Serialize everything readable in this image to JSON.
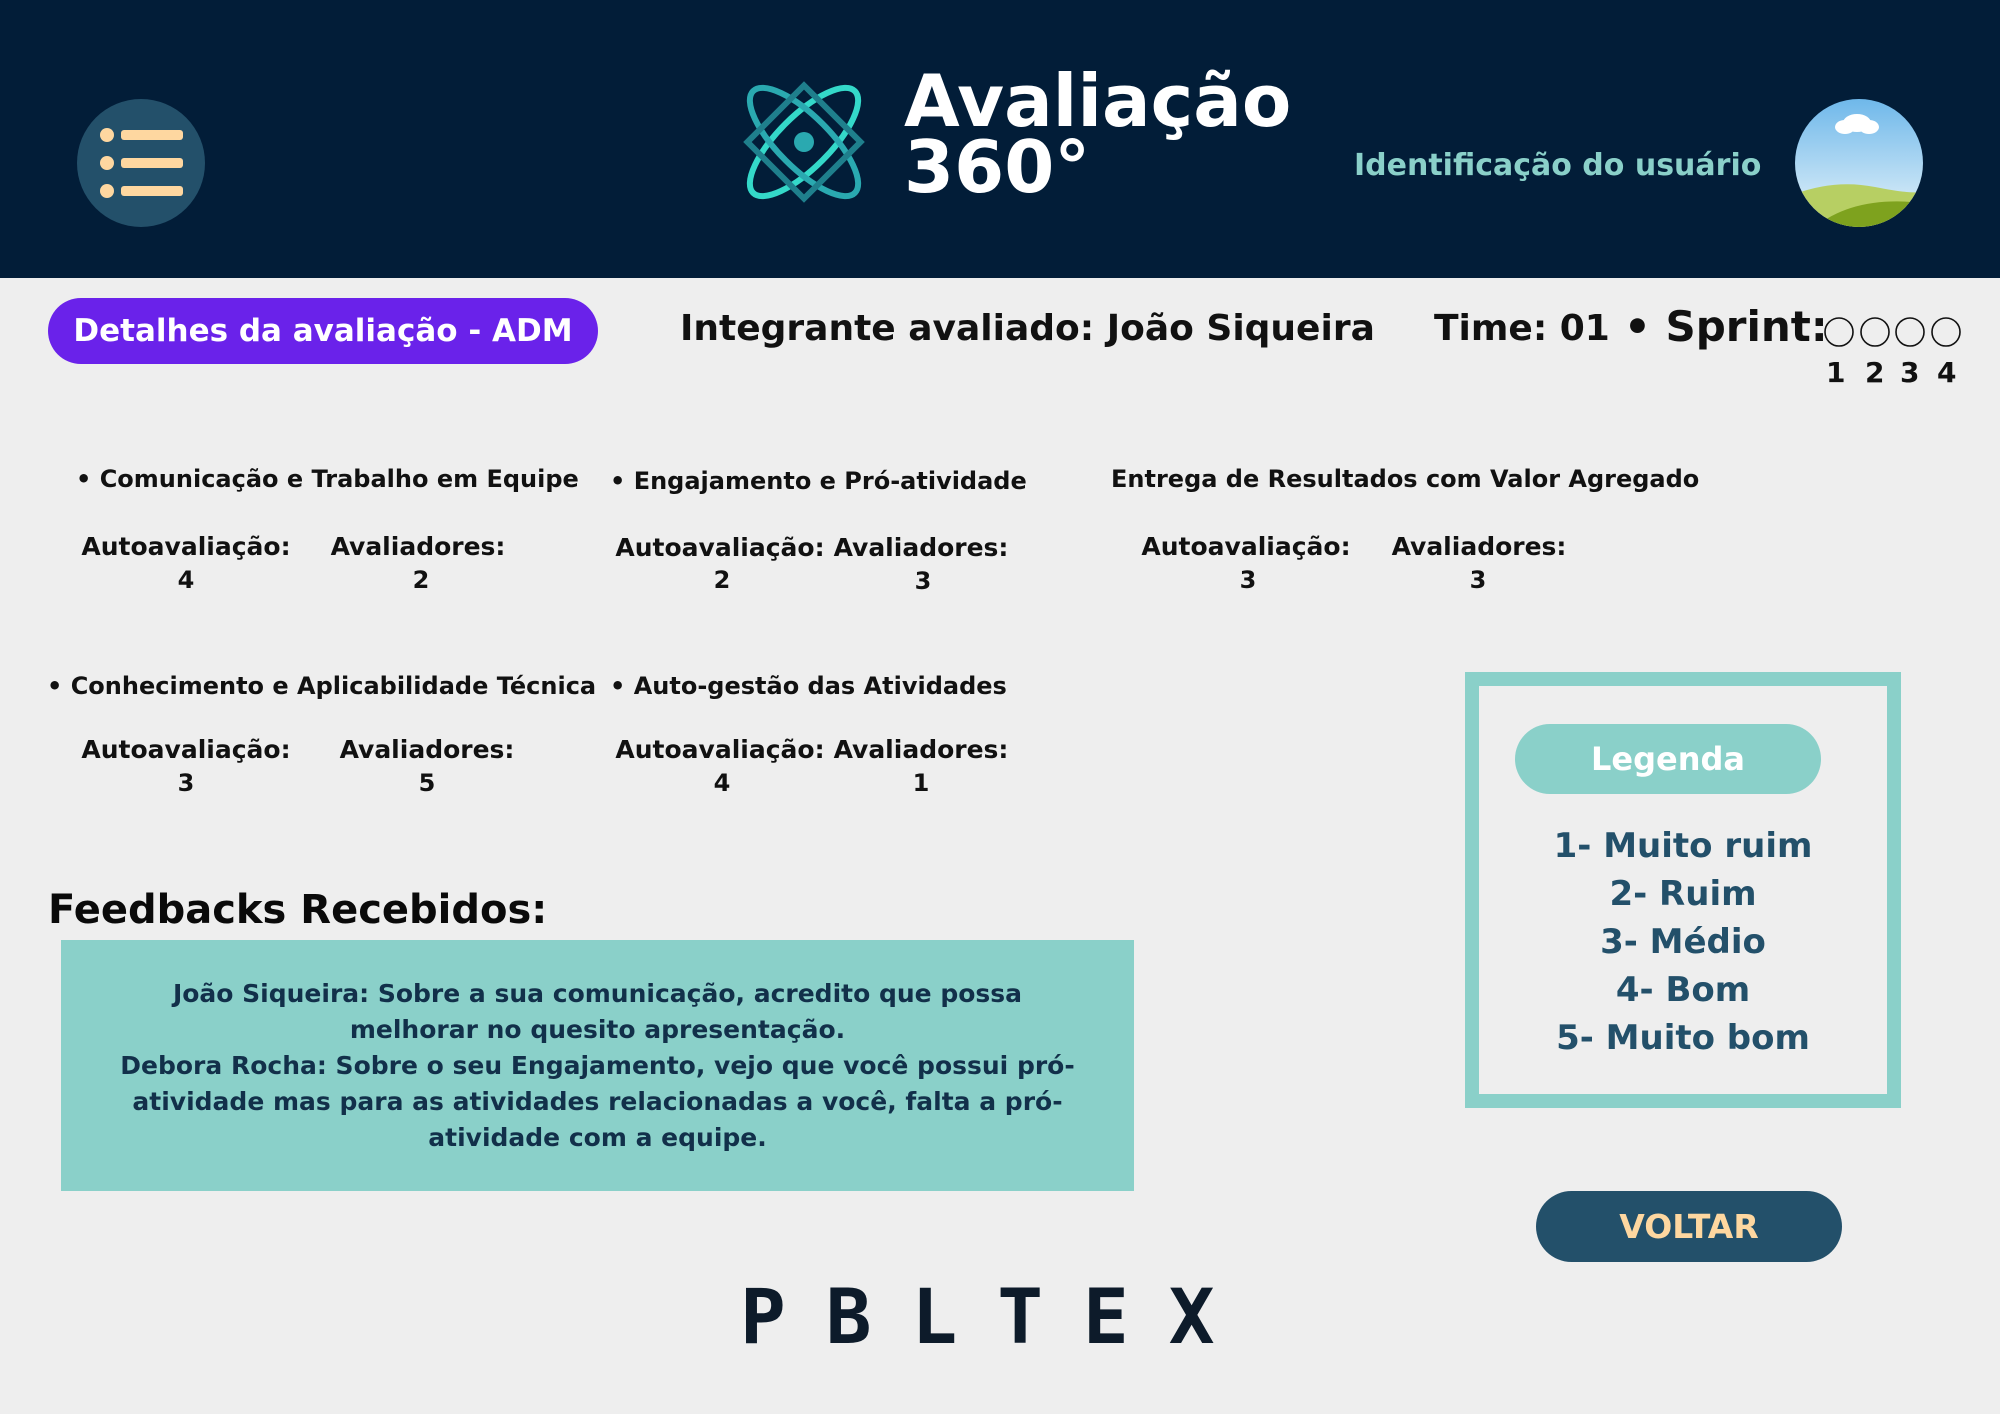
{
  "header": {
    "brand_line1": "Avaliação",
    "brand_line2": "360°",
    "user_id_label": "Identificação do usuário",
    "menu_icon": "hamburger-list-icon",
    "avatar_icon": "landscape-avatar-icon"
  },
  "subheader": {
    "details_label": "Detalhes da avaliação - ADM",
    "integrante": "Integrante avaliado: João Siqueira",
    "time": "Time: 01",
    "sprint_label": "• Sprint:",
    "sprint_options": [
      "1",
      "2",
      "3",
      "4"
    ]
  },
  "criteria": [
    {
      "title": "• Comunicação e Trabalho em Equipe",
      "self_label": "Autoavaliação:",
      "self_value": "4",
      "eval_label": "Avaliadores:",
      "eval_value": "2"
    },
    {
      "title": "• Engajamento e Pró-atividade",
      "self_label": "Autoavaliação:",
      "self_value": "2",
      "eval_label": "Avaliadores:",
      "eval_value": "3"
    },
    {
      "title": "Entrega de Resultados com Valor Agregado",
      "self_label": "Autoavaliação:",
      "self_value": "3",
      "eval_label": "Avaliadores:",
      "eval_value": "3"
    },
    {
      "title": "• Conhecimento e Aplicabilidade Técnica",
      "self_label": "Autoavaliação:",
      "self_value": "3",
      "eval_label": "Avaliadores:",
      "eval_value": "5"
    },
    {
      "title": "• Auto-gestão das Atividades",
      "self_label": "Autoavaliação:",
      "self_value": "4",
      "eval_label": "Avaliadores:",
      "eval_value": "1"
    }
  ],
  "feedback": {
    "title": "Feedbacks Recebidos:",
    "items": [
      "João Siqueira: Sobre a sua comunicação, acredito que possa melhorar no quesito apresentação.",
      "Debora Rocha: Sobre o seu Engajamento, vejo que você possui pró-atividade mas para as atividades relacionadas a você, falta a pró-atividade com a equipe."
    ]
  },
  "legend": {
    "title": "Legenda",
    "items": [
      "1- Muito ruim",
      "2- Ruim",
      "3- Médio",
      "4- Bom",
      "5- Muito bom"
    ]
  },
  "actions": {
    "back_label": "VOLTAR"
  },
  "footer": {
    "logo_text": "PBLTEX"
  },
  "colors": {
    "header_bg": "#021d38",
    "accent_purple": "#6a22ea",
    "teal": "#8ad0c9",
    "dark_blue": "#23506a",
    "peach": "#fed7a0"
  }
}
